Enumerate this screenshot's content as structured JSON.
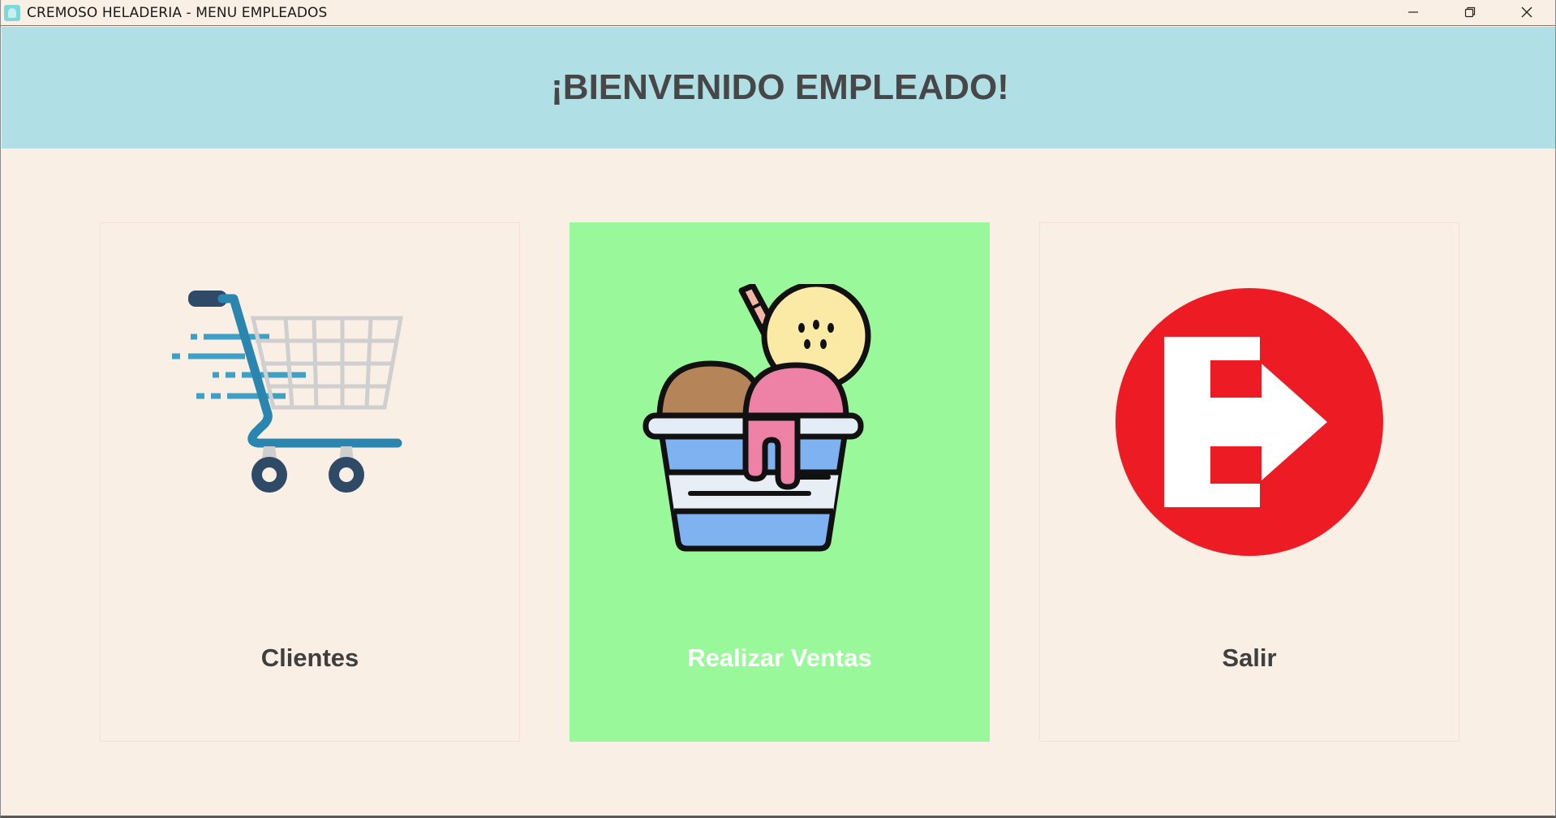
{
  "window": {
    "title": "CREMOSO HELADERIA - MENU EMPLEADOS",
    "controls": [
      "minimize-icon",
      "restore-icon",
      "close-icon"
    ]
  },
  "header": {
    "welcome": "¡BIENVENIDO EMPLEADO!",
    "background_color": "#b0dfe5"
  },
  "menu": {
    "cards": [
      {
        "label": "Clientes",
        "icon": "shopping-cart-icon",
        "active": false
      },
      {
        "label": "Realizar Ventas",
        "icon": "ice-cream-cup-icon",
        "active": true
      },
      {
        "label": "Salir",
        "icon": "exit-icon",
        "active": false
      }
    ],
    "active_color": "#99f99a",
    "background_color": "#faefe5"
  }
}
